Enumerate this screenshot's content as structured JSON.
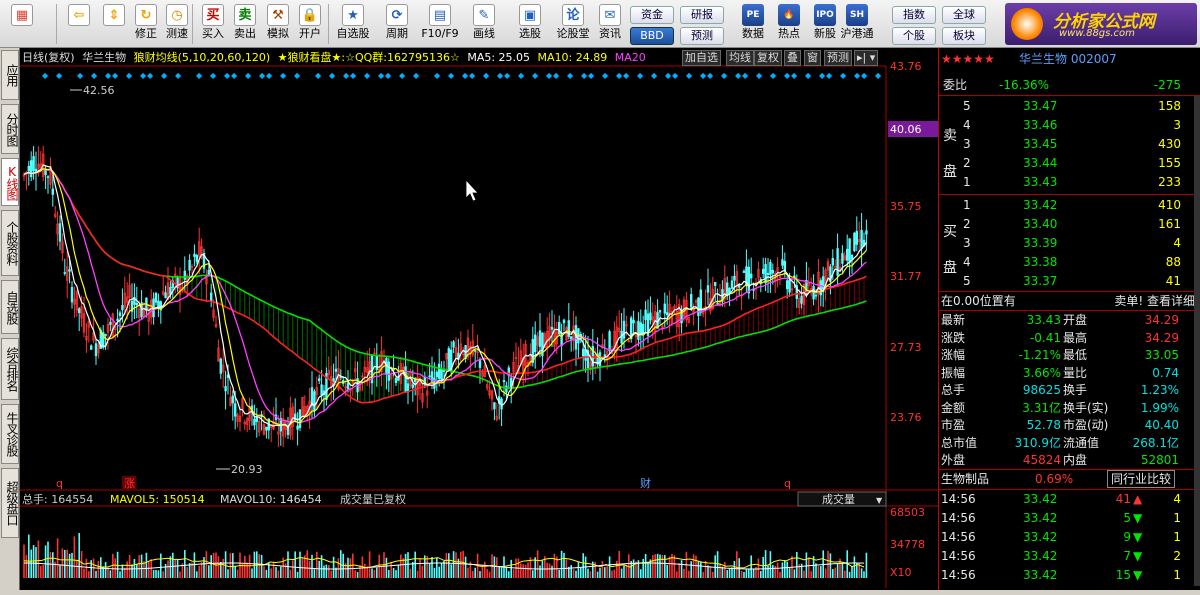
{
  "toolbar": {
    "buttons": [
      {
        "label": "",
        "icon": "app-grid-icon",
        "glyph": "▦",
        "color": "#e04030"
      },
      {
        "label": "",
        "icon": "back-arrow-icon",
        "glyph": "⇦",
        "color": "#f0a000"
      },
      {
        "label": "",
        "icon": "up-down-arrows-icon",
        "glyph": "⇕",
        "color": "#f0a000"
      },
      {
        "label": "修正",
        "icon": "refresh-icon",
        "glyph": "↻",
        "color": "#f0a000"
      },
      {
        "label": "测速",
        "icon": "clock-icon",
        "glyph": "◷",
        "color": "#e08000"
      },
      {
        "label": "买入",
        "icon": "buy-icon",
        "glyph": "买",
        "color": "#d00000"
      },
      {
        "label": "卖出",
        "icon": "sell-icon",
        "glyph": "卖",
        "color": "#008000"
      },
      {
        "label": "模拟",
        "icon": "hammer-icon",
        "glyph": "⚒",
        "color": "#a04000"
      },
      {
        "label": "开户",
        "icon": "lock-icon",
        "glyph": "🔒",
        "color": "#806000"
      },
      {
        "label": "自选股",
        "icon": "star-folder-icon",
        "glyph": "★",
        "color": "#2060c0"
      },
      {
        "label": "周期",
        "icon": "period-icon",
        "glyph": "⟳",
        "color": "#2060c0"
      },
      {
        "label": "F10/F9",
        "icon": "f10-icon",
        "glyph": "▤",
        "color": "#2060c0"
      },
      {
        "label": "画线",
        "icon": "draw-line-icon",
        "glyph": "✎",
        "color": "#2060c0"
      },
      {
        "label": "选股",
        "icon": "screen-stock-icon",
        "glyph": "▣",
        "color": "#2060c0"
      },
      {
        "label": "论股堂",
        "icon": "forum-icon",
        "glyph": "论",
        "color": "#2060c0"
      },
      {
        "label": "资讯",
        "icon": "news-icon",
        "glyph": "✉",
        "color": "#2060c0"
      }
    ],
    "small_buttons": [
      "资金",
      "研报",
      "BBD",
      "预测"
    ],
    "right_buttons": [
      {
        "label": "数据",
        "icon": "pe-data-icon",
        "glyph": "PE"
      },
      {
        "label": "热点",
        "icon": "hotspot-icon",
        "glyph": "🔥"
      },
      {
        "label": "新股",
        "icon": "ipo-icon",
        "glyph": "IPO"
      },
      {
        "label": "沪港通",
        "icon": "shhk-icon",
        "glyph": "SH"
      }
    ],
    "index_buttons": [
      "指数",
      "全球",
      "个股",
      "板块"
    ],
    "logo_text": "分析家公式网",
    "logo_url": "www.88gs.com"
  },
  "left_tabs": [
    {
      "label": "应用",
      "active": false
    },
    {
      "label": "分时图",
      "active": false
    },
    {
      "label": "K线图",
      "active": true
    },
    {
      "label": "个股资料",
      "active": false
    },
    {
      "label": "自选股",
      "active": false
    },
    {
      "label": "综合排名",
      "active": false
    },
    {
      "label": "牛叉诊股",
      "active": false
    },
    {
      "label": "超级盘口",
      "active": false
    }
  ],
  "kline_header": {
    "period": "日线(复权)",
    "name": "华兰生物",
    "indicator": "狼财均线(5,10,20,60,120)",
    "note": "★狼财看盘★:☆QQ群:162795136☆",
    "ma5": "MA5: 25.05",
    "ma10": "MA10: 24.89",
    "ma20": "MA20",
    "buttons": [
      "加自选",
      "均线",
      "复权",
      "叠",
      "窗",
      "预测"
    ]
  },
  "price_axis": {
    "labels": [
      "43.76",
      "40.06",
      "35.75",
      "31.77",
      "27.73",
      "23.76"
    ],
    "current": "40.06",
    "high_mark": "42.56",
    "low_mark": "20.93"
  },
  "event_marks": [
    "q",
    "涨",
    "财",
    "q"
  ],
  "volume_header": {
    "total": "总手: 164554",
    "mavol5": "MAVOL5: 150514",
    "mavol10": "MAVOL10: 146454",
    "note": "成交量已复权",
    "selector": "成交量"
  },
  "volume_axis": [
    "68503",
    "34778",
    "X10"
  ],
  "quote": {
    "title": "华兰生物 002007",
    "webi_label": "委比",
    "webi": "-16.36%",
    "weicha": "-275",
    "sell_label": "卖盘",
    "buy_label": "买盘",
    "sell": [
      {
        "lvl": "5",
        "price": "33.47",
        "vol": "158"
      },
      {
        "lvl": "4",
        "price": "33.46",
        "vol": "3"
      },
      {
        "lvl": "3",
        "price": "33.45",
        "vol": "430"
      },
      {
        "lvl": "2",
        "price": "33.44",
        "vol": "155"
      },
      {
        "lvl": "1",
        "price": "33.43",
        "vol": "233"
      }
    ],
    "buy": [
      {
        "lvl": "1",
        "price": "33.42",
        "vol": "410"
      },
      {
        "lvl": "2",
        "price": "33.40",
        "vol": "161"
      },
      {
        "lvl": "3",
        "price": "33.39",
        "vol": "4"
      },
      {
        "lvl": "4",
        "price": "33.38",
        "vol": "88"
      },
      {
        "lvl": "5",
        "price": "33.37",
        "vol": "41"
      }
    ],
    "position_text": "在0.00位置有",
    "position_right": "卖单! 查看详细",
    "stats": [
      [
        "最新",
        "33.43",
        "开盘",
        "34.29"
      ],
      [
        "涨跌",
        "-0.41",
        "最高",
        "34.29"
      ],
      [
        "涨幅",
        "-1.21%",
        "最低",
        "33.05"
      ],
      [
        "振幅",
        "3.66%",
        "量比",
        "0.74"
      ],
      [
        "总手",
        "98625",
        "换手",
        "1.23%"
      ],
      [
        "金额",
        "3.31亿",
        "换手(实)",
        "1.99%"
      ],
      [
        "市盈",
        "52.78",
        "市盈(动)",
        "40.40"
      ],
      [
        "总市值",
        "310.9亿",
        "流通值",
        "268.1亿"
      ],
      [
        "外盘",
        "45824",
        "内盘",
        "52801"
      ]
    ],
    "industry": "生物制品",
    "industry_pct": "0.69%",
    "industry_btn": "同行业比较",
    "ticks": [
      {
        "time": "14:56",
        "price": "33.42",
        "vol": "41",
        "dir": "up",
        "n": "4"
      },
      {
        "time": "14:56",
        "price": "33.42",
        "vol": "5",
        "dir": "down",
        "n": "1"
      },
      {
        "time": "14:56",
        "price": "33.42",
        "vol": "9",
        "dir": "down",
        "n": "1"
      },
      {
        "time": "14:56",
        "price": "33.42",
        "vol": "7",
        "dir": "down",
        "n": "2"
      },
      {
        "time": "14:56",
        "price": "33.42",
        "vol": "15",
        "dir": "down",
        "n": "1"
      }
    ]
  }
}
